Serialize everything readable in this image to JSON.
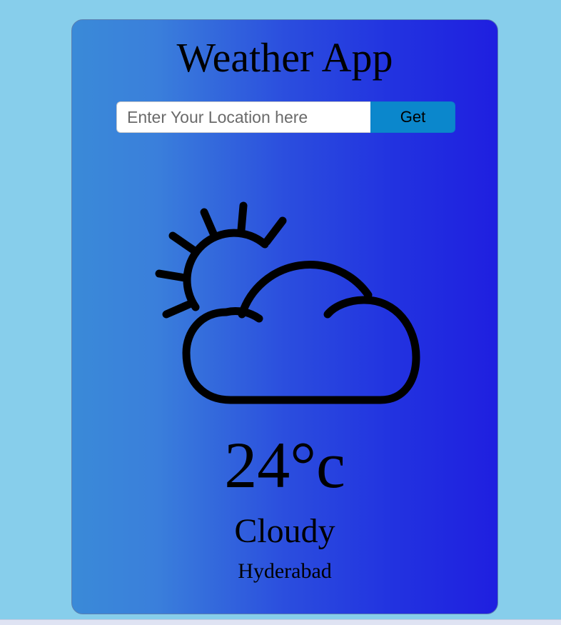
{
  "app": {
    "title": "Weather App"
  },
  "search": {
    "placeholder": "Enter Your Location here",
    "value": "",
    "button_label": "Get"
  },
  "weather": {
    "icon": "partly-cloudy-icon",
    "temperature": "24°c",
    "condition": "Cloudy",
    "location": "Hyderabad"
  },
  "colors": {
    "page_background": "#87ceeb",
    "card_gradient_start": "#3a8ad8",
    "card_gradient_end": "#1f1fe0",
    "button_background": "#0b87cc"
  }
}
